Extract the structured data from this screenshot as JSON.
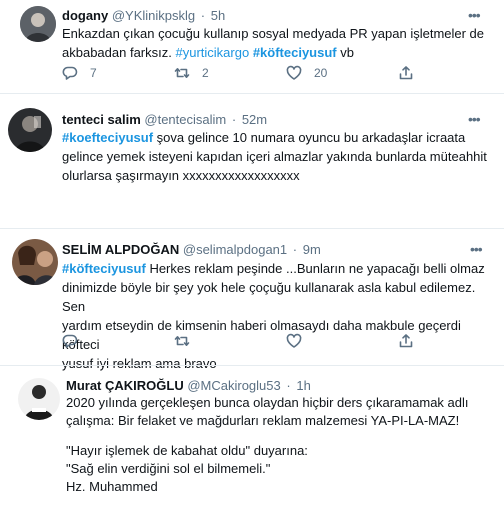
{
  "tweets": [
    {
      "name": "dogany",
      "handle": "@YKlinikpsklg",
      "separator": "·",
      "time": "5h",
      "more": "•••",
      "text_line1": "Enkazdan çıkan çocuğu kullanıp sosyal medyada PR yapan işletmeler de",
      "text_line2_plain": "akbabadan farksız.",
      "hashtag1": "#yurticikargo",
      "hashtag2": "#köfteciyusuf",
      "text_line2_end": "vb",
      "replies": "7",
      "retweets": "2",
      "likes": "20"
    },
    {
      "name": "tenteci salim",
      "handle": "@tentecisalim",
      "separator": "·",
      "time": "52m",
      "more": "•••",
      "hashtag": "#koefteciyusuf",
      "text_line1_rest": "şova gelince 10 numara oyuncu bu arkadaşlar icraata",
      "text_line2": "gelince yemek isteyeni kapıdan içeri almazlar yakında bunlarda müteahhit",
      "text_line3": "olurlarsa şaşırmayın xxxxxxxxxxxxxxxxxx"
    },
    {
      "name": "SELİM ALPDOĞAN",
      "handle": "@selimalpdogan1",
      "separator": "·",
      "time": "9m",
      "more": "•••",
      "hashtag": "#köfteciyusuf",
      "text_line1_rest": "Herkes reklam peşinde ...Bunların ne yapacağı belli olmaz",
      "text_line2": "dinimizde  böyle bir şey yok  hele çoçuğu kullanarak asla kabul edilemez. Sen",
      "text_line3": "yardım etseydin de kimsenin haberi olmasaydı daha makbule geçerdi köfteci",
      "text_line4": "yusuf iyi reklam ama bravo"
    },
    {
      "name": "Murat ÇAKIROĞLU",
      "handle": "@MCakiroglu53",
      "separator": "·",
      "time": "1h",
      "text_line1": "2020 yılında gerçekleşen bunca olaydan hiçbir ders çıkaramamak adlı",
      "text_line2": "çalışma: Bir felaket ve mağdurları reklam malzemesi YA-PI-LA-MAZ!",
      "text_line3": "\"Hayır işlemek de kabahat oldu\" duyarına:",
      "text_line4": "\"Sağ elin verdiğini sol el bilmemeli.\"",
      "text_line5": "Hz. Muhammed"
    }
  ],
  "icons": {
    "reply": "reply-icon",
    "retweet": "retweet-icon",
    "like": "heart-icon",
    "share": "share-icon",
    "more": "more-icon"
  },
  "colors": {
    "text": "#0f1419",
    "secondary": "#5b7083",
    "link": "#1b95e0",
    "divider": "#e6ecf0"
  }
}
